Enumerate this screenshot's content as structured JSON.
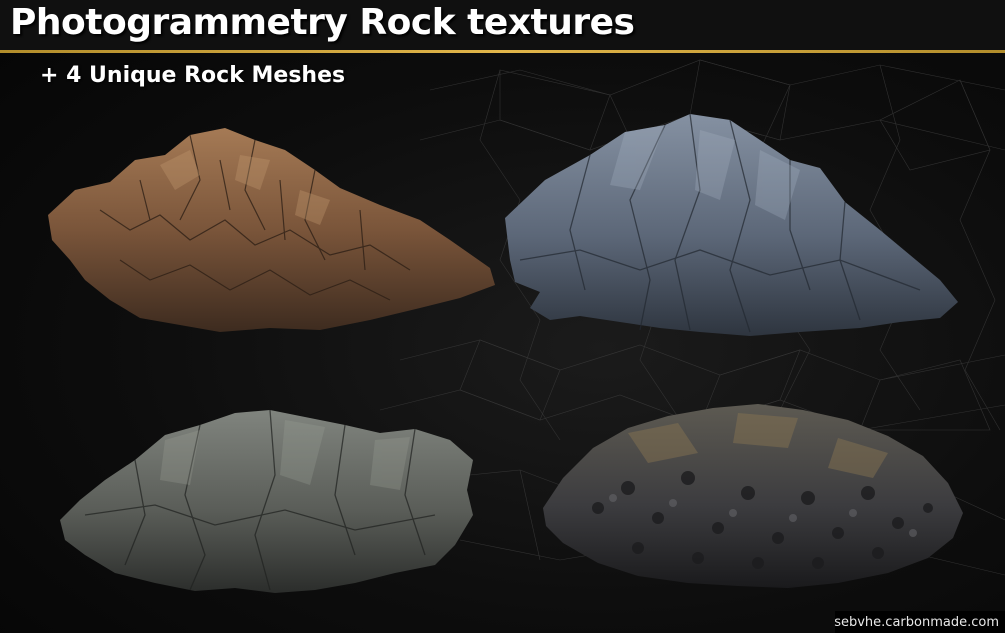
{
  "header": {
    "title": "Photogrammetry Rock textures",
    "subtitle": "+ 4 Unique Rock Meshes"
  },
  "rocks": [
    {
      "name": "brown-rock",
      "color": "#8a6243"
    },
    {
      "name": "blue-gray-rock",
      "color": "#5f6a7a"
    },
    {
      "name": "dark-gray-rock",
      "color": "#5d605c"
    },
    {
      "name": "rubble-rock",
      "color": "#3f3f42"
    }
  ],
  "footer": {
    "credit": "sebvhe.carbonmade.com"
  },
  "colors": {
    "accent": "#e2b64a",
    "background": "#0d0d0d"
  }
}
